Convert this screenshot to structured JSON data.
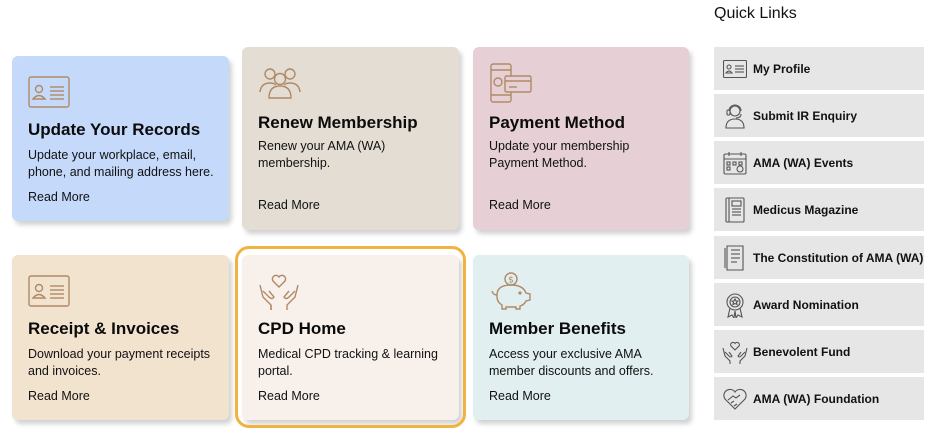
{
  "quick_links": {
    "title": "Quick Links",
    "items": [
      {
        "label": "My Profile",
        "icon": "id-card-icon"
      },
      {
        "label": "Submit IR Enquiry",
        "icon": "support-agent-icon"
      },
      {
        "label": "AMA (WA) Events",
        "icon": "calendar-icon"
      },
      {
        "label": "Medicus Magazine",
        "icon": "magazine-icon"
      },
      {
        "label": "The Constitution of AMA (WA)",
        "icon": "document-icon"
      },
      {
        "label": "Award Nomination",
        "icon": "award-ribbon-icon"
      },
      {
        "label": "Benevolent Fund",
        "icon": "hands-heart-icon"
      },
      {
        "label": "AMA (WA) Foundation",
        "icon": "heart-handshake-icon"
      }
    ]
  },
  "cards": [
    {
      "title": "Update Your Records",
      "desc": "Update your workplace, email, phone, and mailing address here.",
      "more": "Read More",
      "icon": "id-card-icon",
      "color": "#c5d9fb"
    },
    {
      "title": "Renew Membership",
      "desc": "Renew your AMA (WA) membership.",
      "more": "Read More",
      "icon": "people-group-icon",
      "color": "#e4ddd3"
    },
    {
      "title": "Payment Method",
      "desc": "Update your membership Payment Method.",
      "more": "Read More",
      "icon": "mobile-payment-icon",
      "color": "#e6d0d5"
    },
    {
      "title": "Receipt & Invoices",
      "desc": "Download your payment receipts and invoices.",
      "more": "Read More",
      "icon": "id-card-icon",
      "color": "#f2e3cf"
    },
    {
      "title": "CPD Home",
      "desc": "Medical CPD tracking & learning portal.",
      "more": "Read More",
      "icon": "hands-heart-icon",
      "color": "#f8f0eb"
    },
    {
      "title": "Member Benefits",
      "desc": "Access your exclusive AMA member discounts and offers.",
      "more": "Read More",
      "icon": "piggy-bank-icon",
      "color": "#e1eff0"
    }
  ],
  "colors": {
    "icon_stroke": "#b08a66",
    "focus_ring": "#f0b341",
    "quick_link_bg": "#e6e6e6"
  }
}
